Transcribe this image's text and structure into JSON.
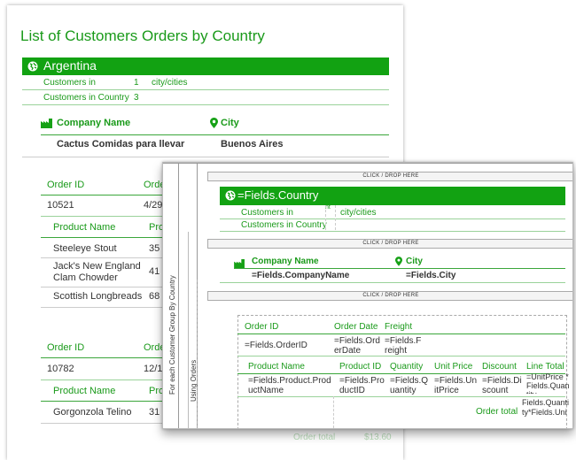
{
  "report": {
    "title": "List of Customers Orders by Country",
    "country_header": "Argentina",
    "customers_in_label": "Customers in",
    "customers_in_value": "1",
    "customers_in_unit": "city/cities",
    "customers_in_country_label": "Customers in Country",
    "customers_in_country_value": "3",
    "company_name_header": "Company Name",
    "city_header": "City",
    "company_name": "Cactus Comidas para llevar",
    "city": "Buenos Aires",
    "order_id_header": "Order ID",
    "order_date_header_partial": "Order",
    "product_name_header": "Product Name",
    "product_id_header_partial": "Prod",
    "orders": [
      {
        "order_id": "10521",
        "order_date_partial": "4/29/",
        "products": [
          {
            "name": "Steeleye Stout",
            "id": "35"
          },
          {
            "name": "Jack's New England Clam Chowder",
            "id": "41"
          },
          {
            "name": "Scottish Longbreads",
            "id": "68"
          }
        ]
      },
      {
        "order_id": "10782",
        "order_date_partial": "12/17",
        "products": [
          {
            "name": "Gorgonzola Telino",
            "id": "31"
          }
        ]
      }
    ],
    "order_total_label": "Order total",
    "order_total_value": "$13.60"
  },
  "designer": {
    "drop_bar_label": "CLICK / DROP HERE",
    "country_field": "=Fields.Country",
    "customers_in_label": "Customers in",
    "customers_in_partial": "nt",
    "customers_in_unit": "city/cities",
    "customers_in_country_label": "Customers in Country",
    "company_name_header": "Company Name",
    "city_header": "City",
    "company_field": "=Fields.CompanyName",
    "city_field": "=Fields.City",
    "group_label": "For each Customer Group By Country",
    "using_orders_label": "Using Orders",
    "order_id_header": "Order ID",
    "order_date_header": "Order Date",
    "freight_header": "Freight",
    "order_id_field": "=Fields.OrderID",
    "order_date_field": "=Fields.OrderDate",
    "freight_field": "=Fields.Freight",
    "product_name_header": "Product Name",
    "product_id_header": "Product ID",
    "quantity_header": "Quantity",
    "unit_price_header": "Unit Price",
    "discount_header": "Discount",
    "line_total_header": "Line Total",
    "product_name_field": "=Fields.Product.ProductName",
    "product_id_field": "=Fields.ProductID",
    "quantity_field": "=Fields.Quantity",
    "unit_price_field": "=Fields.UnitPrice",
    "discount_field": "=Fields.Discount",
    "line_total_field": "=UnitPrice *Fields.Quantity",
    "order_total_label": "Order total",
    "order_total_field": "Fields.Quantity*Fields.Uni"
  },
  "colors": {
    "accent": "#16a116",
    "header_bg": "#12a212"
  }
}
